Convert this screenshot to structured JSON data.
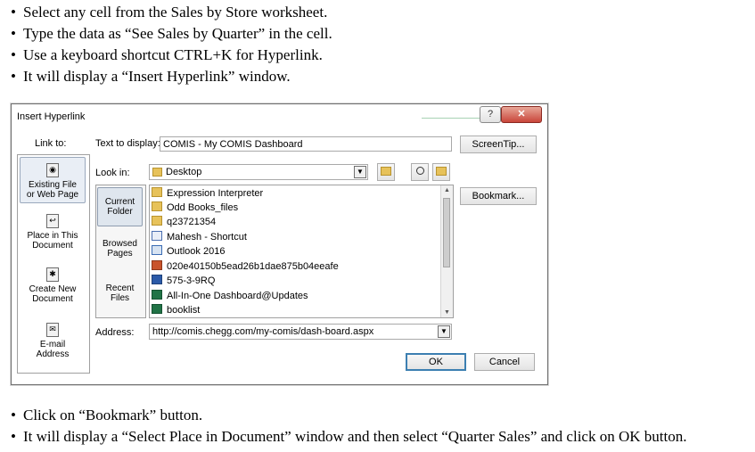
{
  "instructions_top": [
    "Select any cell from the Sales by Store worksheet.",
    "Type the data as “See Sales by Quarter” in the cell.",
    "Use a keyboard shortcut CTRL+K for Hyperlink.",
    "It will display a “Insert Hyperlink” window."
  ],
  "instructions_bottom": [
    "Click on “Bookmark” button.",
    "It will display a “Select Place in Document” window and then select “Quarter Sales” and click on OK button."
  ],
  "bullet": "•",
  "dialog": {
    "title": "Insert Hyperlink",
    "help_label": "?",
    "close_label": "✕",
    "link_to_label": "Link to:",
    "text_to_display_label": "Text to display:",
    "text_to_display_value": "COMIS - My COMIS Dashboard",
    "screentip_label": "ScreenTip...",
    "look_in_label": "Look in:",
    "look_in_value": "Desktop",
    "bookmark_label": "Bookmark...",
    "address_label": "Address:",
    "address_value": "http://comis.chegg.com/my-comis/dash-board.aspx",
    "ok_label": "OK",
    "cancel_label": "Cancel",
    "link_targets": [
      {
        "line1": "Existing File",
        "line2": "or Web Page",
        "icon": "existing-file-icon",
        "selected": true
      },
      {
        "line1": "Place in This",
        "line2": "Document",
        "icon": "place-in-document-icon",
        "selected": false
      },
      {
        "line1": "Create New",
        "line2": "Document",
        "icon": "create-new-document-icon",
        "selected": false
      },
      {
        "line1": "E-mail",
        "line2": "Address",
        "icon": "email-address-icon",
        "selected": false
      }
    ],
    "browse_tabs": [
      {
        "line1": "Current",
        "line2": "Folder",
        "selected": true
      },
      {
        "line1": "Browsed",
        "line2": "Pages",
        "selected": false
      },
      {
        "line1": "Recent",
        "line2": "Files",
        "selected": false
      }
    ],
    "files": [
      {
        "name": "Expression Interpreter",
        "icon": "folder"
      },
      {
        "name": "Odd Books_files",
        "icon": "folder"
      },
      {
        "name": "q23721354",
        "icon": "folder"
      },
      {
        "name": "Mahesh - Shortcut",
        "icon": "shortcut"
      },
      {
        "name": "Outlook 2016",
        "icon": "webpage"
      },
      {
        "name": "020e40150b5ead26b1dae875b04eeafe",
        "icon": "ppt"
      },
      {
        "name": "575-3-9RQ",
        "icon": "doc"
      },
      {
        "name": "All-In-One Dashboard@Updates",
        "icon": "xls"
      },
      {
        "name": "booklist",
        "icon": "xls"
      }
    ]
  }
}
